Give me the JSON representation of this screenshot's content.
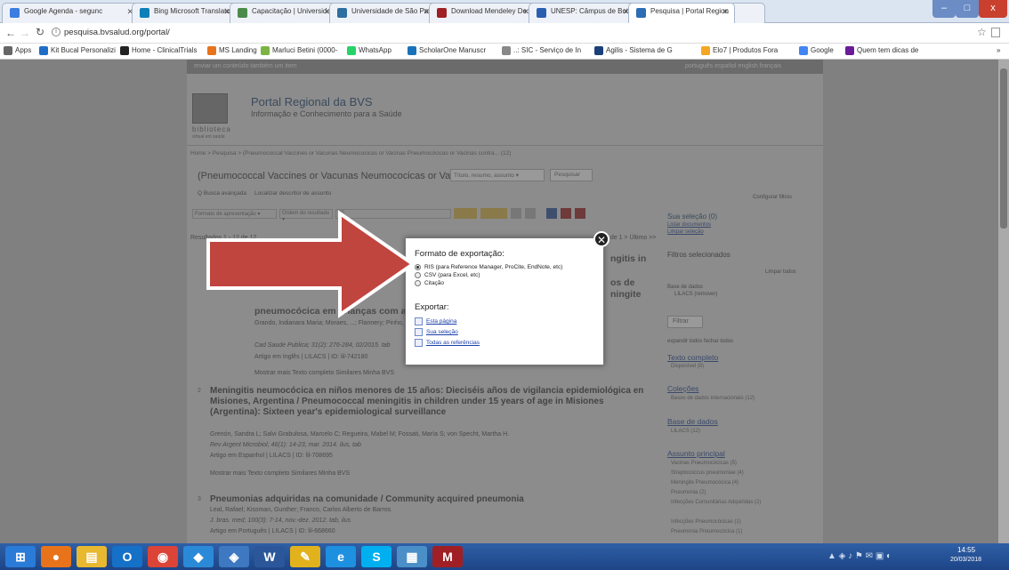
{
  "tabs": [
    {
      "label": "Google Agenda - segunc",
      "color": "#3b7de0"
    },
    {
      "label": "Bing Microsoft Translato",
      "color": "#0f7fb8"
    },
    {
      "label": "Capacitação | Universida",
      "color": "#4c8a4c"
    },
    {
      "label": "Universidade de São Pau",
      "color": "#2d6fa0"
    },
    {
      "label": "Download Mendeley De:",
      "color": "#a01f24"
    },
    {
      "label": "UNESP: Câmpus de Botu",
      "color": "#2a5fb0"
    },
    {
      "label": "Pesquisa | Portal Region",
      "color": "#2c6db3"
    }
  ],
  "window": {
    "minimize": "–",
    "maximize": "□",
    "close": "x"
  },
  "address": {
    "url": "pesquisa.bvsalud.org/portal/",
    "star": "☆"
  },
  "bookmarks": [
    {
      "label": "Apps",
      "color": "#666"
    },
    {
      "label": "Kit Bucal Personalizi",
      "color": "#1e6ec8"
    },
    {
      "label": "Home - ClinicalTrials",
      "color": "#222"
    },
    {
      "label": "MS Landing",
      "color": "#e8731a"
    },
    {
      "label": "Marluci Betini (0000-",
      "color": "#7cb342"
    },
    {
      "label": "WhatsApp",
      "color": "#25d366"
    },
    {
      "label": "ScholarOne Manuscr",
      "color": "#1a73b8"
    },
    {
      "label": "..: SIC - Serviço de In",
      "color": "#888"
    },
    {
      "label": "Agilis - Sistema de G",
      "color": "#1b3f7a"
    },
    {
      "label": "Elo7 | Produtos Fora",
      "color": "#f5a623"
    },
    {
      "label": "Google",
      "color": "#4285f4"
    },
    {
      "label": "Quem tem dicas de",
      "color": "#6a1b9a"
    }
  ],
  "site": {
    "skip_link": "enviar um conteúdo também um item",
    "languages": "português  español  english  français",
    "logo_text": "biblioteca",
    "logo_sub": "virtual em saúde",
    "portal_title": "Portal Regional da BVS",
    "portal_subtitle": "Informação e Conhecimento para a Saúde",
    "breadcrumb": "Home > Pesquisa > (Pneumococcal Vaccines or Vacunas Neumococicas or Vacinas Pneumocócicas or Vacinas contra... (12)",
    "query": "(Pneumococcal Vaccines or Vacunas Neumococicas or Vacinas",
    "search_field": "Título, resumo, assunto",
    "search_button": "Pesquisar",
    "advanced": "Busca avançada",
    "decs": "Localizar descritor de assunto",
    "config_filters": "Configurar filtros",
    "format_select": "Formato de apresentação",
    "order_select": "Ordem do resultado",
    "per_page": "20",
    "results_count": "Resultados 1 - 12 de 12",
    "pager": "1 de 1 >  Último >>",
    "results": [
      {
        "num": "1",
        "title": "pneumocócica em crianças com até d...",
        "title_right": "ngitis in",
        "title_right2": "os de",
        "title_right3": "ningite",
        "authors": "Grando, Indianara Maria; Moraes, ...; Flannery; Pinho, Diana Lúcia Moura; Nascimento, Gilmara Lim...",
        "source": "Cad Saude Publica; 31(2): 276-284, 02/2015. tab",
        "meta": "Artigo em Inglês | LILACS | ID: lil-742180",
        "actions": "Mostrar mais   Texto completo   Similares   Minha BVS"
      },
      {
        "num": "2",
        "title": "Meningitis neumocócica en niños menores de 15 años: Dieciséis años de vigilancia epidemiológica en Misiones, Argentina / Pneumococcal meningitis in children under 15 years of age in Misiones (Argentina): Sixteen year's epidemiological surveillance",
        "authors": "Grenón, Sandra L; Salvi Grabulosa, Marcelo C; Regueira, Mabel M; Fossati, María S; von Specht, Martha H.",
        "source": "Rev Argent Microbiol; 46(1): 14-23, mar. 2014. ilus, tab",
        "meta": "Artigo em Espanhol | LILACS | ID: lil-708695",
        "actions": "Mostrar mais   Texto completo   Similares   Minha BVS"
      },
      {
        "num": "3",
        "title": "Pneumonias adquiridas na comunidade / Community acquired pneumonia",
        "authors": "Leal, Rafael; Kissman, Gunther; Franco, Carlos Alberto de Barros.",
        "source": "J. bras. med; 100(3): 7-14, nov.-dez. 2012. tab, ilus",
        "meta": "Artigo em Português | LILACS | ID: lil-668660",
        "actions": ""
      }
    ],
    "sidebar": {
      "selection": "Sua seleção (0)",
      "list_docs": "Listar documentos",
      "clear_sel": "Limpar seleção",
      "filters_sel": "Filtros selecionados",
      "clear_all": "Limpar todos",
      "db_label": "Base de dados",
      "db_value": "LILACS (remover)",
      "filter_btn": "Filtrar",
      "expand": "expandir todos  fechar todos",
      "facets": [
        {
          "title": "Texto completo",
          "items": [
            "Disponível (8)"
          ]
        },
        {
          "title": "Coleções",
          "items": [
            "Bases de dados internacionais (12)"
          ]
        },
        {
          "title": "Base de dados",
          "items": [
            "LILACS (12)"
          ]
        },
        {
          "title": "Assunto principal",
          "items": [
            "Vacinas Pneumocócicas (5)",
            "Streptococcus pneumoniae (4)",
            "Meningite Pneumocócica (4)",
            "Pneumonia (2)",
            "Infecções Comunitárias Adquiridas (2)",
            "Infecções Pneumocócicas (1)",
            "Pneumonia Pneumocócica (1)"
          ]
        }
      ]
    }
  },
  "modal": {
    "heading": "Formato de exportação:",
    "options": [
      {
        "label": "RIS (para Reference Manager, ProCite, EndNote, etc)",
        "selected": true
      },
      {
        "label": "CSV (para Excel, etc)",
        "selected": false
      },
      {
        "label": "Citação",
        "selected": false
      }
    ],
    "export_heading": "Exportar:",
    "links": [
      "Esta página",
      "Sua seleção",
      "Todas as referências"
    ],
    "close": "✕"
  },
  "taskbar": {
    "apps": [
      {
        "icon": "windows-start-icon",
        "glyph": "⊞",
        "color": "#2a7bd8"
      },
      {
        "icon": "firefox-icon",
        "glyph": "●",
        "color": "#e8731a"
      },
      {
        "icon": "file-explorer-icon",
        "glyph": "▤",
        "color": "#e8b830"
      },
      {
        "icon": "outlook-icon",
        "glyph": "O",
        "color": "#1570c8"
      },
      {
        "icon": "chrome-icon",
        "glyph": "◉",
        "color": "#db4437"
      },
      {
        "icon": "media-icon",
        "glyph": "◆",
        "color": "#2b8ad8"
      },
      {
        "icon": "network-icon",
        "glyph": "◈",
        "color": "#3d78c0"
      },
      {
        "icon": "word-icon",
        "glyph": "W",
        "color": "#2b579a"
      },
      {
        "icon": "paint-icon",
        "glyph": "✎",
        "color": "#e2b21c"
      },
      {
        "icon": "ie-icon",
        "glyph": "e",
        "color": "#1e90e0"
      },
      {
        "icon": "skype-icon",
        "glyph": "S",
        "color": "#00aff0"
      },
      {
        "icon": "notepad-icon",
        "glyph": "▦",
        "color": "#4a8fc8"
      },
      {
        "icon": "mendeley-icon",
        "glyph": "M",
        "color": "#a01f24"
      }
    ],
    "time": "14:55",
    "date": "20/03/2018"
  }
}
